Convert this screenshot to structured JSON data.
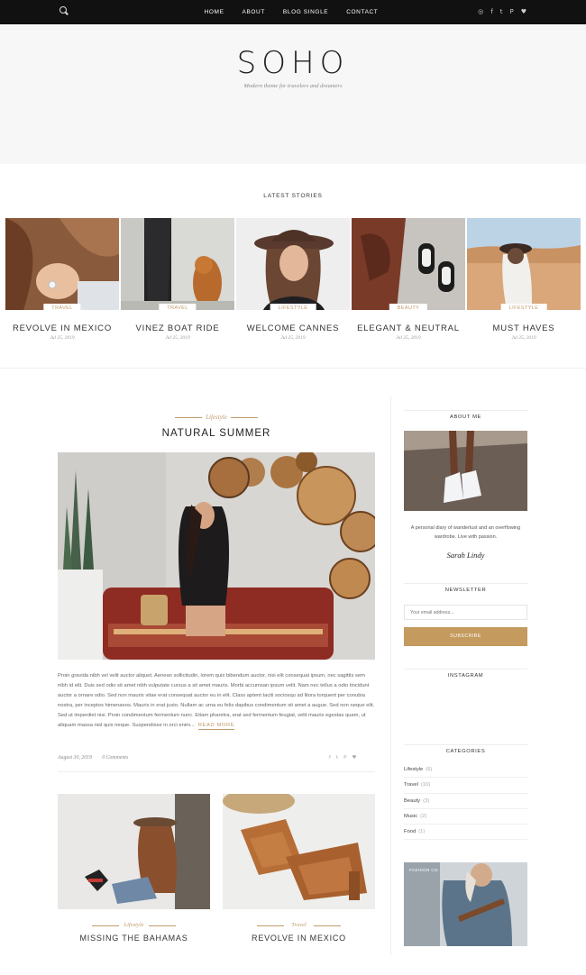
{
  "nav": {
    "items": [
      "HOME",
      "ABOUT",
      "BLOG SINGLE",
      "CONTACT"
    ]
  },
  "social": [
    "◎",
    "f",
    "t",
    "P",
    "♥"
  ],
  "hero": {
    "logo": "SOHO",
    "tagline": "Modern theme for travelers and dreamers"
  },
  "latest": {
    "title": "LATEST STORIES",
    "cards": [
      {
        "category": "TRAVEL",
        "title": "REVOLVE IN MEXICO",
        "date": "Jul 25, 2019"
      },
      {
        "category": "TRAVEL",
        "title": "VINEZ BOAT RIDE",
        "date": "Jul 25, 2019"
      },
      {
        "category": "LIFESTYLE",
        "title": "WELCOME CANNES",
        "date": "Jul 25, 2019"
      },
      {
        "category": "BEAUTY",
        "title": "ELEGANT & NEUTRAL",
        "date": "Jul 25, 2019"
      },
      {
        "category": "LIFESTYLE",
        "title": "MUST HAVES",
        "date": "Jul 25, 2019"
      }
    ]
  },
  "post": {
    "category": "Lifestyle",
    "title": "NATURAL SUMMER",
    "excerpt": "Proin gravida nibh vel velit auctor aliquet. Aenean sollicitudin, lorem quis bibendum auctor, nisi elit consequat ipsum, nec sagittis sem nibh id elit. Duis sed odio sit amet nibh vulputate cursus a sit amet mauris. Morbi accumsan ipsum velit. Nam nec tellus a odio tincidunt auctor a ornare odio. Sed non mauris vitae erat consequat auctor eu in elit. Class aptent taciti sociosqu ad litora torquent per conubia nostra, per inceptos himenaeos. Mauris in erat justo. Nullam ac urna eu felis dapibus condimentum sit amet a augue. Sed non neque elit. Sed ut imperdiet nisi. Proin condimentum fermentum nunc. Etiam pharetra, erat sed fermentum feugiat, velit mauris egestas quam, ut aliquam massa nisl quis neque. Suspendisse in orci enim...",
    "read_more": "READ MORE",
    "date": "August 30, 2019",
    "comments": "0 Comments",
    "share": [
      "f",
      "t",
      "P",
      "♥"
    ]
  },
  "minis": [
    {
      "category": "Lifestyle",
      "title": "MISSING THE BAHAMAS"
    },
    {
      "category": "Travel",
      "title": "REVOLVE IN MEXICO"
    }
  ],
  "sidebar": {
    "about_title": "ABOUT ME",
    "about_text": "A personal diary of wanderlust and an overflowing wardrobe. Live with passion.",
    "signature": "Sarah Lindy",
    "newsletter_title": "NEWSLETTER",
    "email_placeholder": "Your email address...",
    "subscribe": "SUBSCRIBE",
    "instagram_title": "INSTAGRAM",
    "categories_title": "CATEGORIES",
    "categories": [
      {
        "name": "Lifestyle",
        "count": "(6)"
      },
      {
        "name": "Travel",
        "count": "(10)"
      },
      {
        "name": "Beauty",
        "count": "(3)"
      },
      {
        "name": "Music",
        "count": "(2)"
      },
      {
        "name": "Food",
        "count": "(1)"
      }
    ],
    "ad_caption": "FASHION CO."
  }
}
